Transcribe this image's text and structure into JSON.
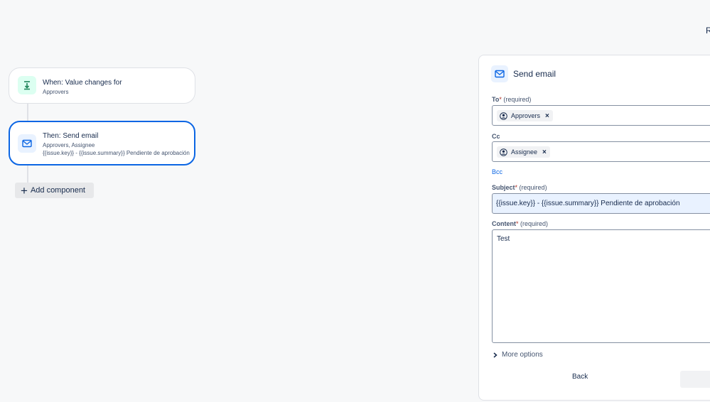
{
  "top_right_text": "R",
  "flow": {
    "trigger": {
      "title": "When: Value changes for",
      "subtitle": "Approvers",
      "icon": "field-change-icon",
      "icon_color": "#1f845a"
    },
    "action": {
      "title": "Then: Send email",
      "line1": "Approvers, Assignee",
      "line2": "{{issue.key}} - {{issue.summary}} Pendiente de aprobación",
      "icon": "mail-icon",
      "selected_border_color": "#0c66e4"
    },
    "add_component_label": "Add component"
  },
  "panel": {
    "title": "Send email",
    "to": {
      "label": "To",
      "required_text": "(required)",
      "chips": [
        "Approvers"
      ]
    },
    "cc": {
      "label": "Cc",
      "chips": [
        "Assignee"
      ]
    },
    "bcc_label": "Bcc",
    "subject": {
      "label": "Subject",
      "required_text": "(required)",
      "value": "{{issue.key}} - {{issue.summary}} Pendiente de aprobación"
    },
    "content": {
      "label": "Content",
      "required_text": "(required)",
      "value": "Test"
    },
    "more_options_label": "More options",
    "back_label": "Back"
  },
  "colors": {
    "accent": "#0c66e4",
    "trigger_icon_bg": "#dcfff1",
    "action_icon_bg": "#e9f2ff"
  }
}
